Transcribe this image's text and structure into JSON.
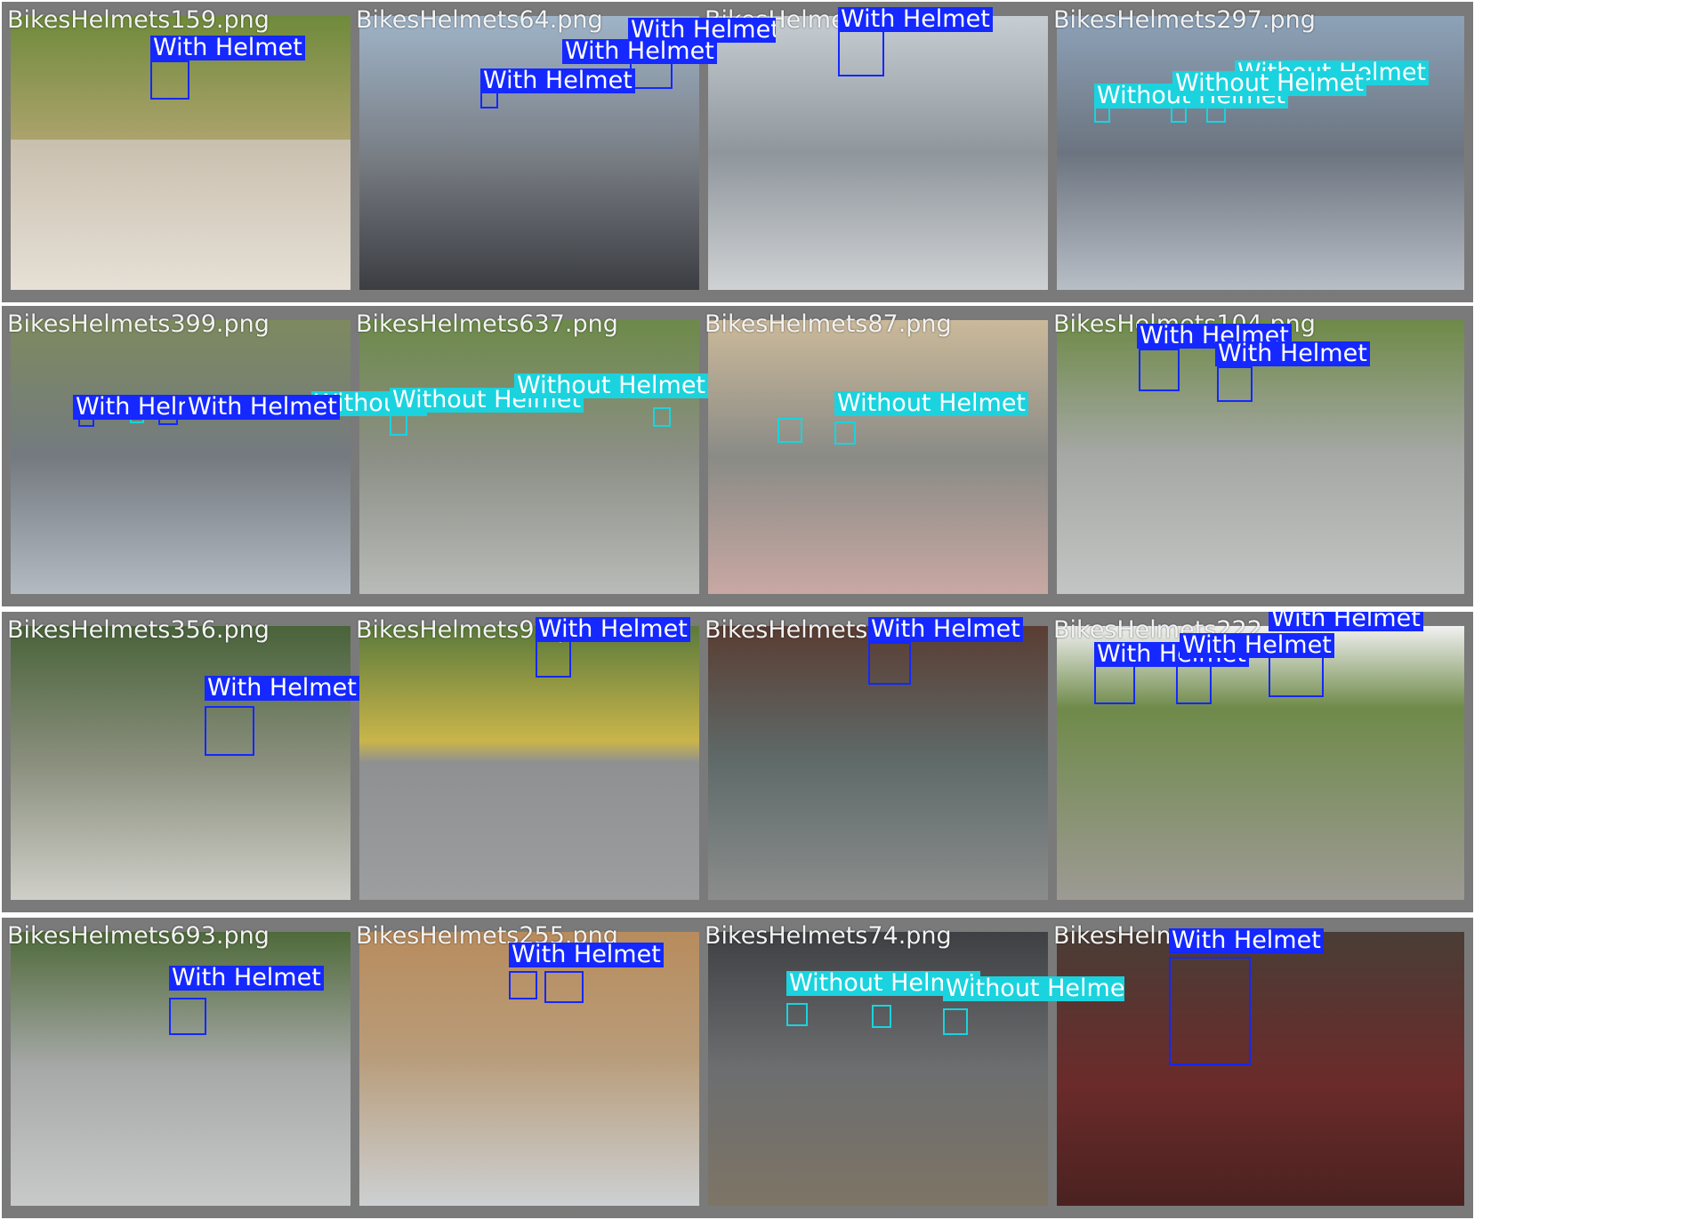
{
  "colors": {
    "with_helmet": "#1428ff",
    "without_helmet": "#1ad3de",
    "tile_frame": "#7a7a7a",
    "filename_text": "#f2f2f2"
  },
  "labels": {
    "with": "With Helmet",
    "without": "Without Helmet"
  },
  "tiles": [
    {
      "filename": "BikesHelmets159.png"
    },
    {
      "filename": "BikesHelmets64.png"
    },
    {
      "filename": "BikesHelmet"
    },
    {
      "filename": "BikesHelmets297.png"
    },
    {
      "filename": "BikesHelmets399.png"
    },
    {
      "filename": "BikesHelmets637.png"
    },
    {
      "filename": "BikesHelmets87.png"
    },
    {
      "filename": "BikesHelmets104.png"
    },
    {
      "filename": "BikesHelmets356.png"
    },
    {
      "filename": "BikesHelmets92.p"
    },
    {
      "filename": "BikesHelmets27"
    },
    {
      "filename": "BikesHelmets222"
    },
    {
      "filename": "BikesHelmets693.png"
    },
    {
      "filename": "BikesHelmets255.png"
    },
    {
      "filename": "BikesHelmets74.png"
    },
    {
      "filename": "BikesHelme"
    }
  ]
}
